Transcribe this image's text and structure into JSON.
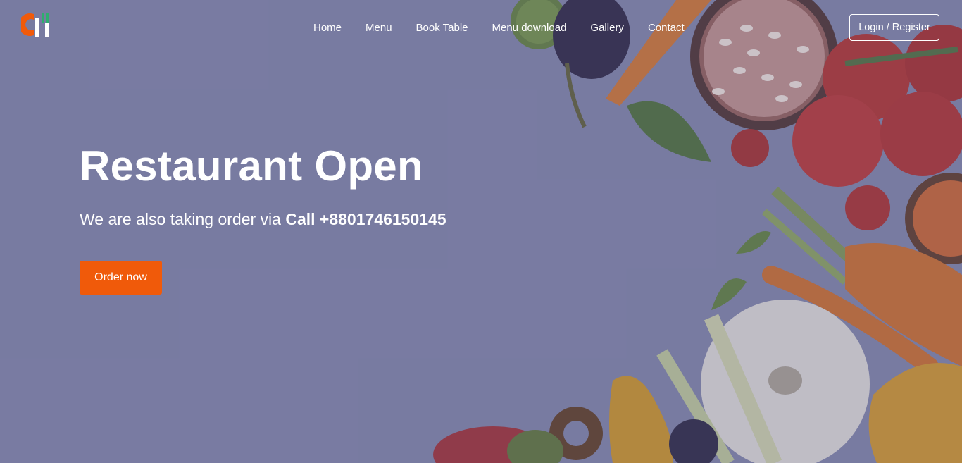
{
  "colors": {
    "accent": "#f05a0a",
    "overlay": "#7c7ea2",
    "text": "#ffffff"
  },
  "logo": {
    "icon": "restaurant-logo-icon"
  },
  "nav": {
    "items": [
      {
        "label": "Home"
      },
      {
        "label": "Menu"
      },
      {
        "label": "Book Table"
      },
      {
        "label": "Menu download"
      },
      {
        "label": "Gallery"
      },
      {
        "label": "Contact"
      }
    ],
    "login_label": "Login / Register"
  },
  "hero": {
    "title": "Restaurant Open",
    "subtitle_prefix": "We are also taking order via ",
    "subtitle_strong": "Call +8801746150145",
    "cta_label": "Order now"
  }
}
